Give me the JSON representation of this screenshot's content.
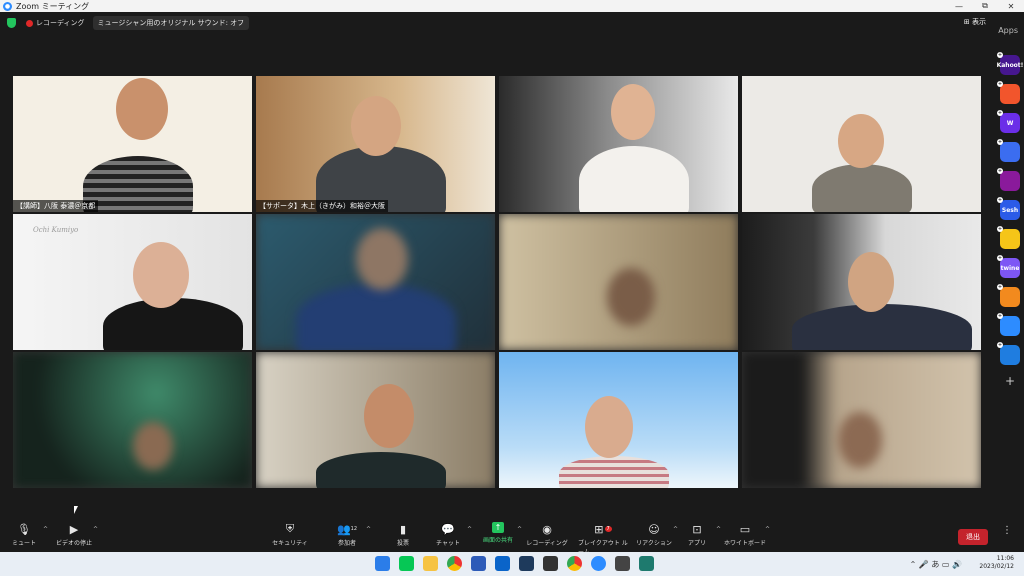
{
  "window": {
    "title": "Zoom ミーティング",
    "minimize": "—",
    "maximize": "⧉",
    "close": "✕"
  },
  "topbar": {
    "recording_label": "レコーディング",
    "sound_label": "ミュージシャン用のオリジナル サウンド: オフ",
    "view_label": "表示",
    "apps_label": "Apps"
  },
  "tiles": [
    {
      "name": "【講師】八阪 泰濃＠京都"
    },
    {
      "name": "【サポータ】木上（きがみ）和裕＠大阪"
    },
    {
      "name": ""
    },
    {
      "name": ""
    },
    {
      "name": ""
    },
    {
      "name": ""
    },
    {
      "name": ""
    },
    {
      "name": ""
    },
    {
      "name": ""
    },
    {
      "name": ""
    },
    {
      "name": ""
    },
    {
      "name": ""
    }
  ],
  "tile_overlay_text": "Ochi Kumiyo",
  "sidebar_apps": [
    {
      "label": "Kahoot!",
      "color": "#46178f"
    },
    {
      "label": "",
      "color": "#f2552c"
    },
    {
      "label": "W",
      "color": "#6b2ee8"
    },
    {
      "label": "",
      "color": "#3b6df0"
    },
    {
      "label": "",
      "color": "#8a1a9b"
    },
    {
      "label": "Sesh",
      "color": "#2b5be8"
    },
    {
      "label": "",
      "color": "#f5c518"
    },
    {
      "label": "twine",
      "color": "#7d56f5"
    },
    {
      "label": "",
      "color": "#f28a1e"
    },
    {
      "label": "",
      "color": "#2d8cff"
    },
    {
      "label": "",
      "color": "#1f7de0"
    }
  ],
  "toolbar": {
    "mute": "ミュート",
    "video": "ビデオの停止",
    "security": "セキュリティ",
    "participants": "参加者",
    "participants_count": "12",
    "polls": "投票",
    "chat": "チャット",
    "share": "画面の共有",
    "record": "レコーディング",
    "breakout": "ブレイクアウト ルーム",
    "breakout_badge": "7",
    "reactions": "リアクション",
    "apps": "アプリ",
    "whiteboard": "ホワイトボード",
    "leave": "退出"
  },
  "taskbar": {
    "time": "11:06",
    "date": "2023/02/12",
    "ime": "あ"
  }
}
